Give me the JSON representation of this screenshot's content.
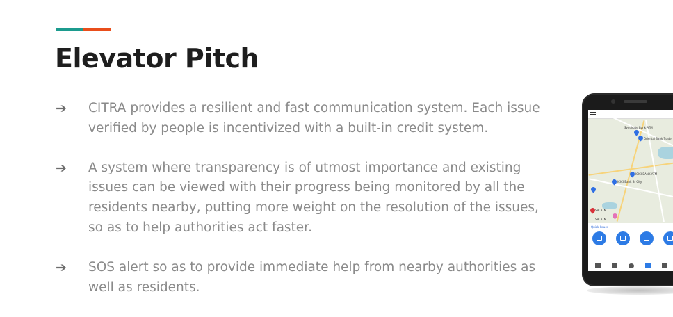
{
  "slide": {
    "title": "Elevator Pitch",
    "accent_colors": [
      "#1c9b8e",
      "#e94e1b"
    ],
    "bullet_icon": "right-arrow-icon",
    "bullet_symbol": "➔",
    "bullets": [
      "CITRA provides a resilient and fast communication system. Each issue verified by people is incentivized with a built-in credit system.",
      "A system where transparency is of utmost importance and existing issues can be viewed with their progress being monitored by all the residents nearby, putting more weight on the resolution of the issues, so as to help authorities act faster.",
      "SOS alert so as to provide immediate help from nearby authorities as well as residents."
    ]
  },
  "phone_app": {
    "map_labels": {
      "l1": "Syndicate Bank ATM",
      "l2": "Oriental Bank Trade",
      "l3": "ICICI BANK ATM",
      "l4": "ICICI Bank Br City",
      "l5": "SBI ATM",
      "l6": "SBI ATM"
    },
    "sheet_title": "Quick Issues"
  }
}
